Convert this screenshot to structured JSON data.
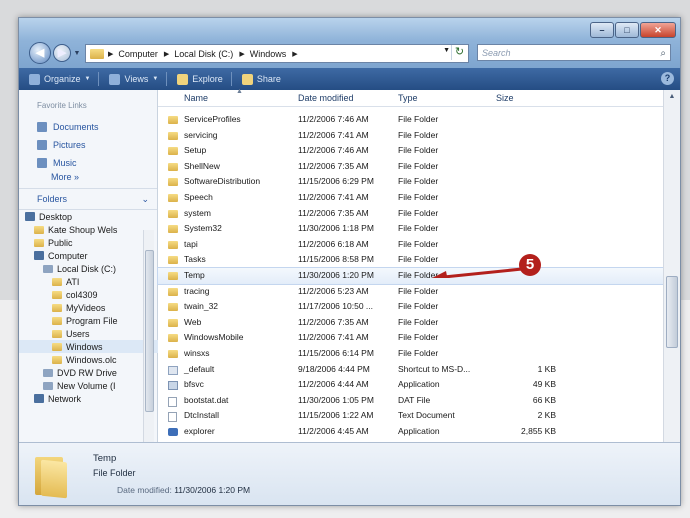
{
  "address": {
    "crumbs": [
      "Computer",
      "Local Disk (C:)",
      "Windows"
    ]
  },
  "search": {
    "placeholder": "Search"
  },
  "toolbar": {
    "organize": "Organize",
    "views": "Views",
    "explore": "Explore",
    "share": "Share"
  },
  "nav": {
    "favorites_title": "Favorite Links",
    "favorites": [
      "Documents",
      "Pictures",
      "Music"
    ],
    "more": "More »",
    "folders_title": "Folders",
    "tree": [
      {
        "label": "Desktop",
        "indent": 0,
        "icon": "desktop"
      },
      {
        "label": "Kate Shoup Wels",
        "indent": 1,
        "icon": "folder"
      },
      {
        "label": "Public",
        "indent": 1,
        "icon": "folder"
      },
      {
        "label": "Computer",
        "indent": 1,
        "icon": "computer"
      },
      {
        "label": "Local Disk (C:)",
        "indent": 2,
        "icon": "drive"
      },
      {
        "label": "ATI",
        "indent": 3,
        "icon": "folder"
      },
      {
        "label": "col4309",
        "indent": 3,
        "icon": "folder"
      },
      {
        "label": "MyVideos",
        "indent": 3,
        "icon": "folder"
      },
      {
        "label": "Program File",
        "indent": 3,
        "icon": "folder"
      },
      {
        "label": "Users",
        "indent": 3,
        "icon": "folder"
      },
      {
        "label": "Windows",
        "indent": 3,
        "icon": "folder",
        "selected": true
      },
      {
        "label": "Windows.olc",
        "indent": 3,
        "icon": "folder"
      },
      {
        "label": "DVD RW Drive",
        "indent": 2,
        "icon": "drive"
      },
      {
        "label": "New Volume (I",
        "indent": 2,
        "icon": "drive"
      },
      {
        "label": "Network",
        "indent": 1,
        "icon": "computer"
      }
    ]
  },
  "columns": {
    "name": "Name",
    "date": "Date modified",
    "type": "Type",
    "size": "Size"
  },
  "files": [
    {
      "name": "ServiceProfiles",
      "date": "11/2/2006 7:46 AM",
      "type": "File Folder",
      "size": "",
      "icon": "folder"
    },
    {
      "name": "servicing",
      "date": "11/2/2006 7:41 AM",
      "type": "File Folder",
      "size": "",
      "icon": "folder"
    },
    {
      "name": "Setup",
      "date": "11/2/2006 7:46 AM",
      "type": "File Folder",
      "size": "",
      "icon": "folder"
    },
    {
      "name": "ShellNew",
      "date": "11/2/2006 7:35 AM",
      "type": "File Folder",
      "size": "",
      "icon": "folder"
    },
    {
      "name": "SoftwareDistribution",
      "date": "11/15/2006 6:29 PM",
      "type": "File Folder",
      "size": "",
      "icon": "folder"
    },
    {
      "name": "Speech",
      "date": "11/2/2006 7:41 AM",
      "type": "File Folder",
      "size": "",
      "icon": "folder"
    },
    {
      "name": "system",
      "date": "11/2/2006 7:35 AM",
      "type": "File Folder",
      "size": "",
      "icon": "folder"
    },
    {
      "name": "System32",
      "date": "11/30/2006 1:18 PM",
      "type": "File Folder",
      "size": "",
      "icon": "folder"
    },
    {
      "name": "tapi",
      "date": "11/2/2006 6:18 AM",
      "type": "File Folder",
      "size": "",
      "icon": "folder"
    },
    {
      "name": "Tasks",
      "date": "11/15/2006 8:58 PM",
      "type": "File Folder",
      "size": "",
      "icon": "folder"
    },
    {
      "name": "Temp",
      "date": "11/30/2006 1:20 PM",
      "type": "File Folder",
      "size": "",
      "icon": "folder",
      "highlight": true
    },
    {
      "name": "tracing",
      "date": "11/2/2006 5:23 AM",
      "type": "File Folder",
      "size": "",
      "icon": "folder"
    },
    {
      "name": "twain_32",
      "date": "11/17/2006 10:50 ...",
      "type": "File Folder",
      "size": "",
      "icon": "folder"
    },
    {
      "name": "Web",
      "date": "11/2/2006 7:35 AM",
      "type": "File Folder",
      "size": "",
      "icon": "folder"
    },
    {
      "name": "WindowsMobile",
      "date": "11/2/2006 7:41 AM",
      "type": "File Folder",
      "size": "",
      "icon": "folder"
    },
    {
      "name": "winsxs",
      "date": "11/15/2006 6:14 PM",
      "type": "File Folder",
      "size": "",
      "icon": "folder"
    },
    {
      "name": "_default",
      "date": "9/18/2006 4:44 PM",
      "type": "Shortcut to MS-D...",
      "size": "1 KB",
      "icon": "shortcut"
    },
    {
      "name": "bfsvc",
      "date": "11/2/2006 4:44 AM",
      "type": "Application",
      "size": "49 KB",
      "icon": "app"
    },
    {
      "name": "bootstat.dat",
      "date": "11/30/2006 1:05 PM",
      "type": "DAT File",
      "size": "66 KB",
      "icon": "doc"
    },
    {
      "name": "DtcInstall",
      "date": "11/15/2006 1:22 AM",
      "type": "Text Document",
      "size": "2 KB",
      "icon": "doc"
    },
    {
      "name": "explorer",
      "date": "11/2/2006 4:45 AM",
      "type": "Application",
      "size": "2,855 KB",
      "icon": "explorer"
    }
  ],
  "details": {
    "name": "Temp",
    "type": "File Folder",
    "date_label": "Date modified:",
    "date_value": "11/30/2006 1:20 PM"
  },
  "callout": {
    "number": "5",
    "color": "#b3201c"
  }
}
